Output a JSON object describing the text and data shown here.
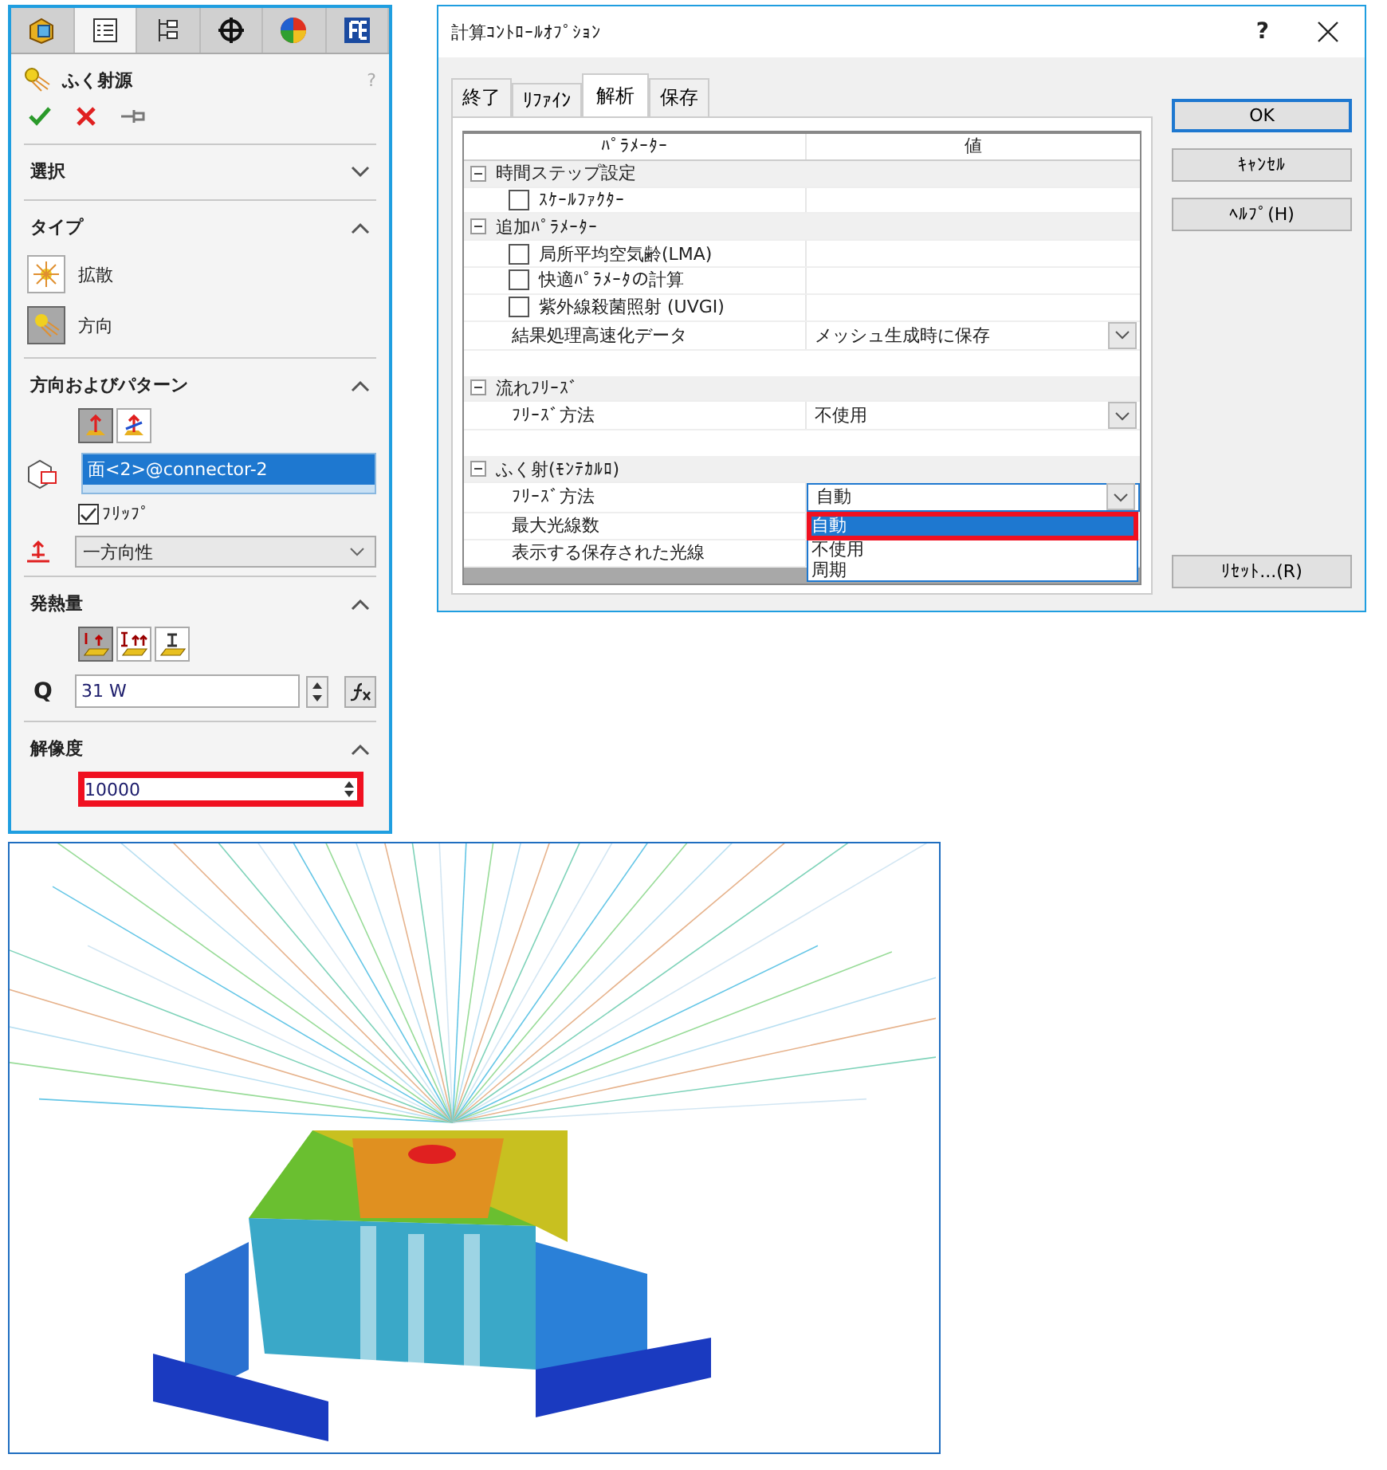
{
  "panel": {
    "tabs": [
      {
        "selected": false
      },
      {
        "selected": true
      },
      {
        "selected": false
      },
      {
        "selected": false
      },
      {
        "selected": false
      },
      {
        "selected": false
      }
    ],
    "title": "ふく射源",
    "help": "?",
    "select_section": {
      "title": "選択",
      "expanded": false
    },
    "type_section": {
      "title": "タイプ",
      "expanded": true,
      "options": [
        {
          "label": "拡散",
          "selected": false
        },
        {
          "label": "方向",
          "selected": true
        }
      ]
    },
    "direction_section": {
      "title": "方向およびパターン",
      "expanded": true,
      "mode_buttons": [
        {
          "selected": true
        },
        {
          "selected": false
        }
      ],
      "face": "面<2>@connector-2",
      "flip": {
        "label": "ﾌﾘｯﾌﾟ",
        "checked": true
      },
      "pattern": "一方向性"
    },
    "heat_section": {
      "title": "発熱量",
      "expanded": true,
      "mode_buttons": [
        {
          "selected": true
        },
        {
          "selected": false
        },
        {
          "selected": false
        }
      ],
      "symbol": "Q",
      "value": "31 W"
    },
    "resolution_section": {
      "title": "解像度",
      "expanded": true,
      "value": "10000",
      "highlighted": true
    }
  },
  "dialog": {
    "title": "計算ｺﾝﾄﾛｰﾙｵﾌﾟｼｮﾝ",
    "help": "?",
    "tabs": [
      {
        "label": "終了",
        "selected": false
      },
      {
        "label": "ﾘﾌｧｲﾝ",
        "selected": false
      },
      {
        "label": "解析",
        "selected": true
      },
      {
        "label": "保存",
        "selected": false
      }
    ],
    "columns": [
      "ﾊﾟﾗﾒｰﾀｰ",
      "値"
    ],
    "rows": [
      {
        "kind": "group",
        "label": "時間ステップ設定"
      },
      {
        "kind": "checkbox",
        "label": "ｽｹｰﾙﾌｧｸﾀｰ",
        "checked": false
      },
      {
        "kind": "group",
        "label": "追加ﾊﾟﾗﾒｰﾀｰ"
      },
      {
        "kind": "checkbox",
        "label": "局所平均空気齢(LMA)",
        "checked": false
      },
      {
        "kind": "checkbox",
        "label": "快適ﾊﾟﾗﾒｰﾀの計算",
        "checked": false
      },
      {
        "kind": "checkbox",
        "label": "紫外線殺菌照射 (UVGI)",
        "checked": false
      },
      {
        "kind": "property",
        "label": "結果処理高速化データ",
        "value": "メッシュ生成時に保存",
        "open": false
      },
      {
        "kind": "spacer"
      },
      {
        "kind": "group",
        "label": "流れﾌﾘｰｽﾞ"
      },
      {
        "kind": "property",
        "label": "ﾌﾘｰｽﾞ方法",
        "value": "不使用",
        "open": false
      },
      {
        "kind": "spacer"
      },
      {
        "kind": "group",
        "label": "ふく射(ﾓﾝﾃｶﾙﾛ)"
      },
      {
        "kind": "property",
        "label": "ﾌﾘｰｽﾞ方法",
        "value": "自動",
        "open": true,
        "options": [
          {
            "label": "自動",
            "selected": true,
            "highlighted": true
          },
          {
            "label": "不使用",
            "selected": false,
            "highlighted": false
          },
          {
            "label": "周期",
            "selected": false,
            "highlighted": false
          }
        ]
      },
      {
        "kind": "label",
        "label": "最大光線数"
      },
      {
        "kind": "label",
        "label": "表示する保存された光線"
      }
    ],
    "buttons": [
      {
        "label": "OK",
        "default": true
      },
      {
        "label": "ｷｬﾝｾﾙ",
        "default": false
      },
      {
        "label": "ﾍﾙﾌﾟ(H)",
        "default": false
      }
    ],
    "reset_button": "ﾘｾｯﾄ...(R)"
  }
}
